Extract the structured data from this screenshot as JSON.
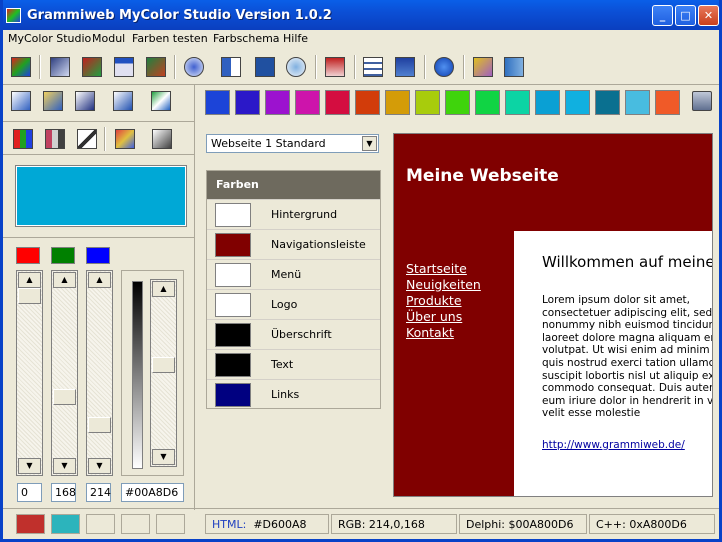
{
  "window": {
    "title": "Grammiweb MyColor Studio Version 1.0.2"
  },
  "menu": [
    "MyColor Studio",
    "Modul",
    "Farben testen",
    "Farbschema",
    "Hilfe"
  ],
  "toolbar_icons": [
    "color-picker-icon",
    "gradient-icon",
    "gradient-2-icon",
    "window-color-icon",
    "palette-strike-icon",
    "web-color-icon",
    "magnifier-grid-icon",
    "info-page-icon",
    "search-zoom-icon",
    "pdf-color-icon",
    "document-grid-icon",
    "download-icon",
    "help-icon",
    "key-icon",
    "exit-door-icon"
  ],
  "toolbar2_icons": [
    "copy-palette-icon",
    "open-palette-icon",
    "save-palette-icon",
    "info-palette-icon",
    "swap-colors-icon"
  ],
  "tool_icons": [
    "rgb-bars-icon",
    "hsb-bars-icon",
    "eyedropper-icon",
    "brush-icon",
    "paint-bucket-icon"
  ],
  "palette": [
    "#1c44d8",
    "#2b18c8",
    "#9c12cf",
    "#cd14ab",
    "#d40d40",
    "#d23c0a",
    "#d49c08",
    "#a8cc0c",
    "#3fd40c",
    "#10d444",
    "#0cd4a4",
    "#0aa0d4",
    "#10b0e0",
    "#0a7090",
    "#48bce0",
    "#f05a28"
  ],
  "trash_icon": "trash-icon",
  "color": {
    "current": "#00A8D6",
    "r": "0",
    "g": "168",
    "b": "214",
    "hex": "#00A8D6"
  },
  "rgb_indicators": [
    "#ff0000",
    "#008000",
    "#0000ff"
  ],
  "recent_colors": [
    "#c0302c",
    "#2cb4bc",
    "#ece9d8",
    "#ece9d8",
    "#ece9d8"
  ],
  "scheme": {
    "selected": "Webseite 1 Standard",
    "header": "Farben",
    "rows": [
      {
        "label": "Hintergrund",
        "color": "#ffffff"
      },
      {
        "label": "Navigationsleiste",
        "color": "#800000"
      },
      {
        "label": "Menü",
        "color": "#ffffff"
      },
      {
        "label": "Logo",
        "color": "#ffffff"
      },
      {
        "label": "Überschrift",
        "color": "#000000"
      },
      {
        "label": "Text",
        "color": "#000000"
      },
      {
        "label": "Links",
        "color": "#000080"
      }
    ]
  },
  "preview": {
    "logo": "Meine Webseite",
    "nav": [
      "Startseite",
      "Neuigkeiten",
      "Produkte",
      "Über uns",
      "Kontakt"
    ],
    "heading": "Willkommen auf meiner",
    "lorem": [
      "Lorem ipsum dolor sit amet,",
      "consectetuer adipiscing elit, sed diam",
      "nonummy nibh euismod tincidunt ut",
      "laoreet dolore magna aliquam erat",
      "volutpat. Ut wisi enim ad minim veniam,",
      "quis nostrud exerci tation ullamcorper",
      "suscipit lobortis nisl ut aliquip ex ea",
      "commodo consequat. Duis autem vel",
      "eum iriure dolor in hendrerit in vulputate",
      "velit esse molestie"
    ],
    "link": "http://www.grammiweb.de/"
  },
  "status": {
    "html_label": "HTML:",
    "html_value": "#D600A8",
    "rgb": "RGB:  214,0,168",
    "delphi": "Delphi:  $00A800D6",
    "cpp": "C++:  0xA800D6"
  },
  "slider_levels": {
    "r": 0,
    "g": 168,
    "b": 214,
    "brightness": 0.44
  }
}
